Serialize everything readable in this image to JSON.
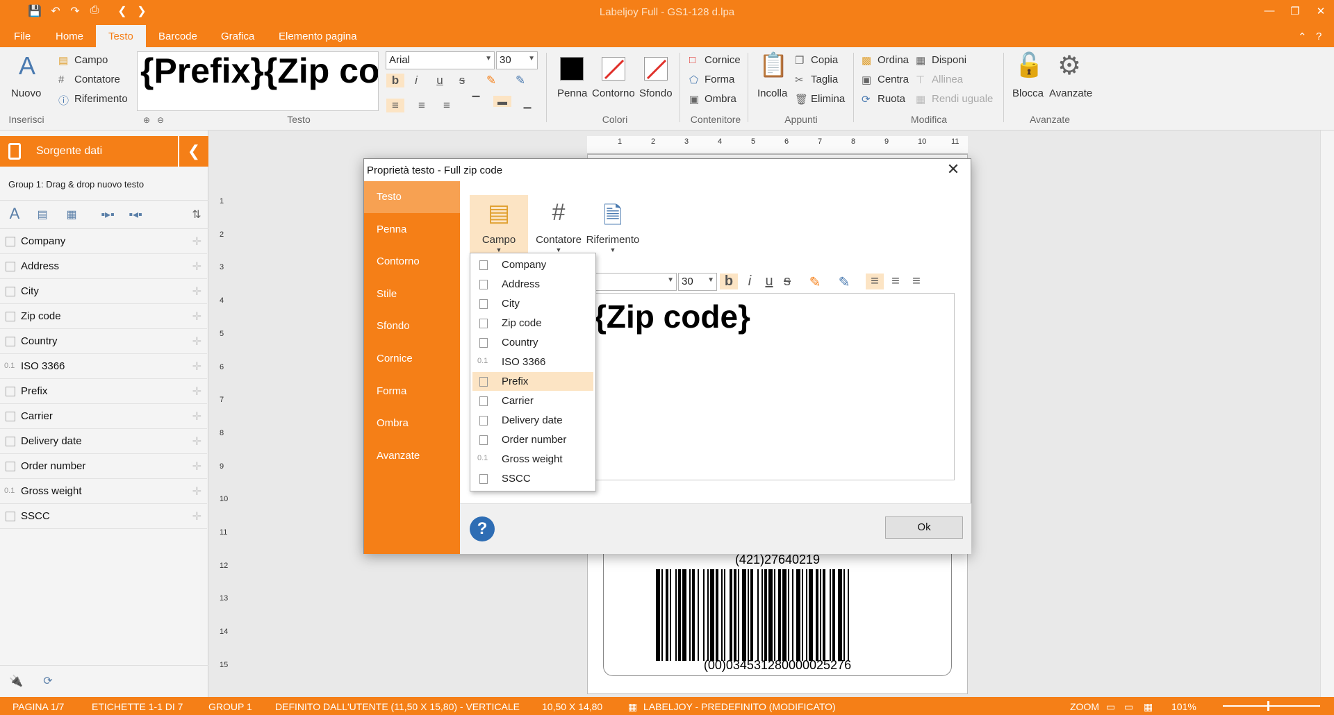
{
  "window": {
    "title": "Labeljoy Full - GS1-128 d.lpa"
  },
  "menu": {
    "tabs": [
      "File",
      "Home",
      "Testo",
      "Barcode",
      "Grafica",
      "Elemento pagina"
    ],
    "active": "Testo"
  },
  "ribbon": {
    "nuovo": "Nuovo",
    "campo": "Campo",
    "contatore": "Contatore",
    "riferimento": "Riferimento",
    "group_inserisci": "Inserisci",
    "preview_text": "{Prefix}{Zip code}",
    "group_testo": "Testo",
    "font": "Arial",
    "size": "30",
    "penna": "Penna",
    "contorno": "Contorno",
    "sfondo": "Sfondo",
    "group_colori": "Colori",
    "cornice": "Cornice",
    "forma": "Forma",
    "ombra": "Ombra",
    "group_contenitore": "Contenitore",
    "incolla": "Incolla",
    "copia": "Copia",
    "taglia": "Taglia",
    "elimina": "Elimina",
    "group_appunti": "Appunti",
    "ordina": "Ordina",
    "disponi": "Disponi",
    "centra": "Centra",
    "allinea": "Allinea",
    "ruota": "Ruota",
    "rendi_uguale": "Rendi uguale",
    "group_modifica": "Modifica",
    "blocca": "Blocca",
    "avanzate": "Avanzate",
    "group_avanzate": "Avanzate"
  },
  "left_panel": {
    "title": "Sorgente dati",
    "group": "Group 1: Drag & drop nuovo testo",
    "fields": [
      {
        "label": "Company",
        "type": "text"
      },
      {
        "label": "Address",
        "type": "text"
      },
      {
        "label": "City",
        "type": "text"
      },
      {
        "label": "Zip code",
        "type": "text"
      },
      {
        "label": "Country",
        "type": "text"
      },
      {
        "label": "ISO 3366",
        "type": "number"
      },
      {
        "label": "Prefix",
        "type": "text"
      },
      {
        "label": "Carrier",
        "type": "text"
      },
      {
        "label": "Delivery date",
        "type": "date"
      },
      {
        "label": "Order number",
        "type": "text"
      },
      {
        "label": "Gross weight",
        "type": "number"
      },
      {
        "label": "SSCC",
        "type": "text"
      }
    ],
    "number_icon": "0.1"
  },
  "ruler": {
    "h": [
      "1",
      "2",
      "3",
      "4",
      "5",
      "6",
      "7",
      "8",
      "9",
      "10",
      "11"
    ],
    "v": [
      "1",
      "2",
      "3",
      "4",
      "5",
      "6",
      "7",
      "8",
      "9",
      "10",
      "11",
      "12",
      "13",
      "14",
      "15"
    ]
  },
  "label": {
    "top_code": "(421)27640219",
    "bottom_code": "(00)034531280000025276"
  },
  "dialog": {
    "title": "Proprietà testo - Full zip code",
    "sidebar": [
      "Testo",
      "Penna",
      "Contorno",
      "Stile",
      "Sfondo",
      "Cornice",
      "Forma",
      "Ombra",
      "Avanzate"
    ],
    "active_sidebar": "Testo",
    "toolbar": {
      "campo": "Campo",
      "contatore": "Contatore",
      "riferimento": "Riferimento"
    },
    "size": "30",
    "editor_text": "{Zip code}",
    "ok": "Ok",
    "help": "?"
  },
  "dropdown": {
    "items": [
      "Company",
      "Address",
      "City",
      "Zip code",
      "Country",
      "ISO 3366",
      "Prefix",
      "Carrier",
      "Delivery date",
      "Order number",
      "Gross weight",
      "SSCC"
    ],
    "highlighted": "Prefix",
    "number_icon": "0.1"
  },
  "status": {
    "page": "PAGINA 1/7",
    "labels": "ETICHETTE 1-1 DI 7",
    "group": "GROUP 1",
    "format": "DEFINITO DALL'UTENTE (11,50 X 15,80) - VERTICALE",
    "size": "10,50 X 14,80",
    "layout": "LABELJOY - PREDEFINITO (MODIFICATO)",
    "zoom_label": "ZOOM",
    "zoom_value": "101%"
  },
  "colors": {
    "accent": "#f57f17",
    "accent_light": "#fce4c4"
  }
}
